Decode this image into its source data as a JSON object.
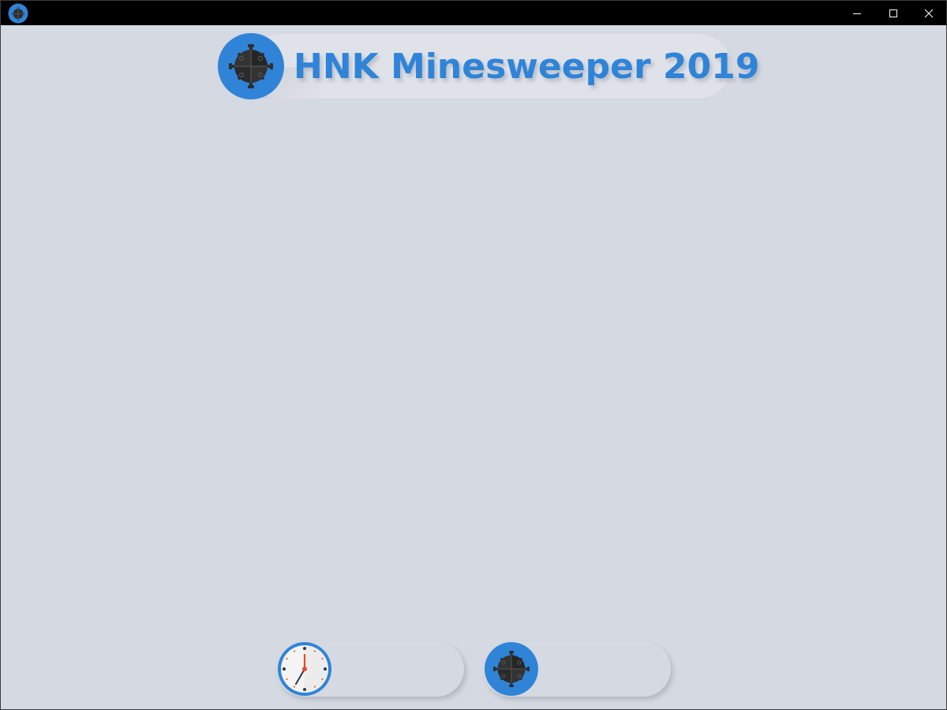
{
  "window": {
    "title": "",
    "controls": {
      "minimize_icon": "minimize-icon",
      "maximize_icon": "maximize-icon",
      "close_icon": "close-icon"
    }
  },
  "header": {
    "title": "HNK Minesweeper 2019",
    "logo_icon": "mine-icon"
  },
  "status": {
    "timer": {
      "icon": "clock-icon",
      "value": ""
    },
    "mines": {
      "icon": "mine-icon",
      "value": ""
    }
  },
  "colors": {
    "accent": "#2f84d8",
    "background": "#d5d9e1",
    "titlebar": "#000000",
    "mine": "#333333"
  }
}
